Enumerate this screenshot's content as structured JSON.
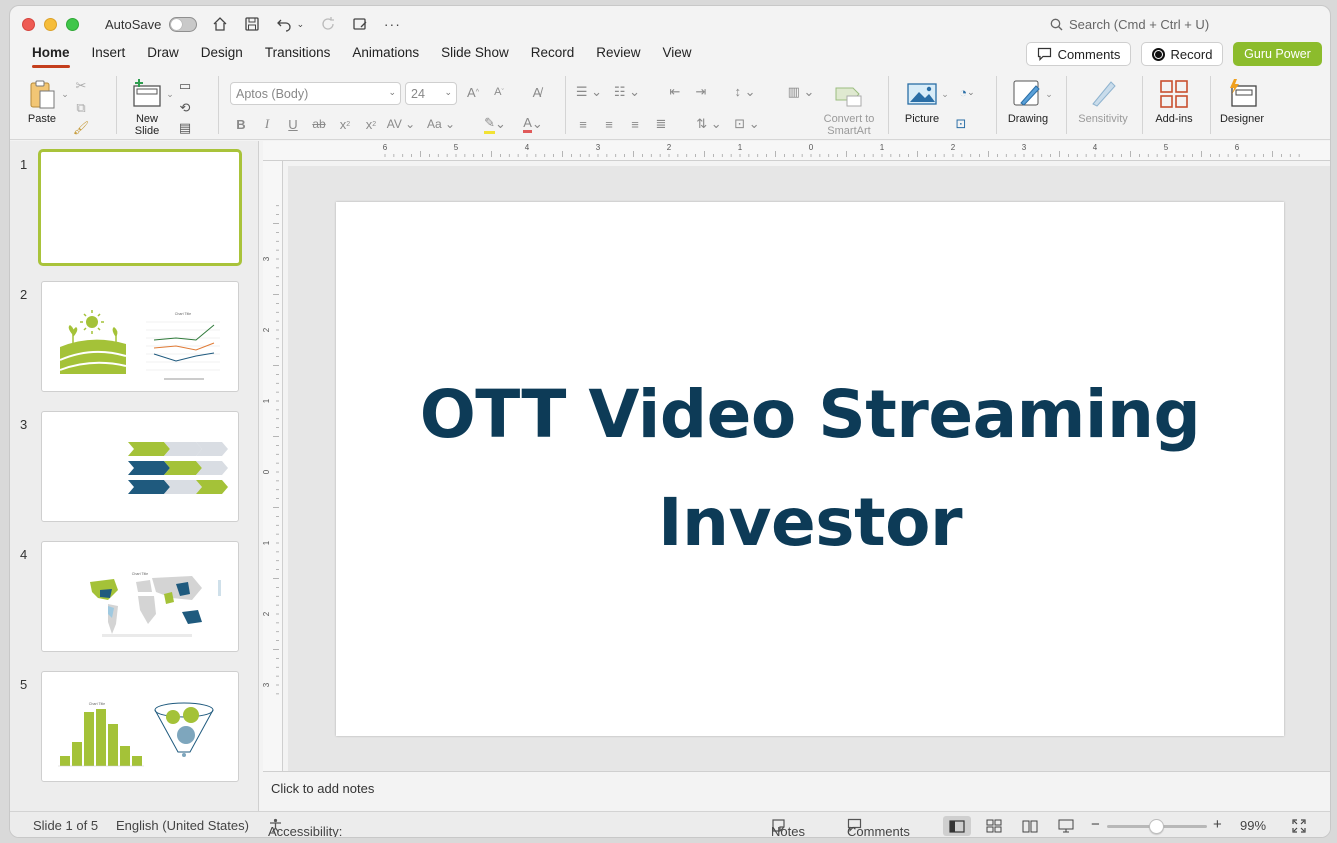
{
  "titlebar": {
    "autosave_label": "AutoSave",
    "search_placeholder": "Search (Cmd + Ctrl + U)"
  },
  "tabs": [
    {
      "label": "Home",
      "active": true
    },
    {
      "label": "Insert"
    },
    {
      "label": "Draw"
    },
    {
      "label": "Design"
    },
    {
      "label": "Transitions"
    },
    {
      "label": "Animations"
    },
    {
      "label": "Slide Show"
    },
    {
      "label": "Record"
    },
    {
      "label": "Review"
    },
    {
      "label": "View"
    }
  ],
  "header_buttons": {
    "comments": "Comments",
    "record": "Record",
    "guru": "Guru Power"
  },
  "ribbon": {
    "paste": "Paste",
    "new_slide": "New\nSlide",
    "font_name": "Aptos (Body)",
    "font_size": "24",
    "convert_smartart": "Convert to\nSmartArt",
    "picture": "Picture",
    "drawing": "Drawing",
    "sensitivity": "Sensitivity",
    "addins": "Add-ins",
    "designer": "Designer"
  },
  "thumbnails": [
    {
      "number": "1",
      "selected": true
    },
    {
      "number": "2",
      "chart_title": "Chart Title"
    },
    {
      "number": "3"
    },
    {
      "number": "4",
      "chart_title": "Chart Title"
    },
    {
      "number": "5",
      "chart_title": "Chart Title"
    }
  ],
  "ruler": {
    "horizontal": [
      "6",
      "5",
      "4",
      "3",
      "2",
      "1",
      "0",
      "1",
      "2",
      "3",
      "4",
      "5",
      "6"
    ],
    "vertical": [
      "3",
      "2",
      "1",
      "0",
      "1",
      "2",
      "3"
    ]
  },
  "slide": {
    "title_line1": "OTT Video Streaming",
    "title_line2": "Investor"
  },
  "notes_placeholder": "Click to add notes",
  "status": {
    "slide_info": "Slide 1 of 5",
    "language": "English (United States)",
    "accessibility": "Accessibility: Investigate",
    "notes": "Notes",
    "comments": "Comments",
    "zoom": "99%"
  },
  "colors": {
    "accent_red": "#c43e1c",
    "guru_green": "#8cbc2c",
    "title_navy": "#0d3b57",
    "thumb_green": "#a4c238",
    "thumb_navy": "#1f5a7e"
  }
}
